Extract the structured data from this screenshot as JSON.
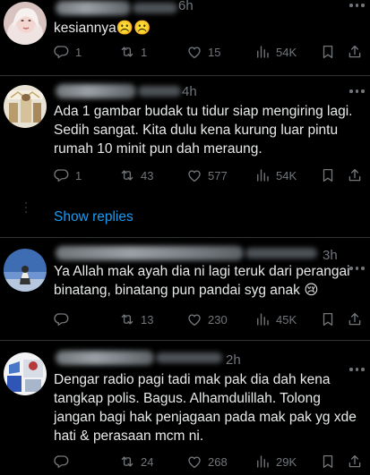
{
  "tweets": [
    {
      "time": "6h",
      "text": "kesiannya☹️☹️",
      "replies": "1",
      "retweets": "1",
      "likes": "15",
      "views": "54K"
    },
    {
      "time": "4h",
      "text": "Ada 1 gambar budak tu tidur siap mengiring lagi. Sedih sangat. Kita dulu kena kurung luar pintu rumah 10 minit pun dah meraung.",
      "replies": "1",
      "retweets": "43",
      "likes": "577",
      "views": "54K"
    },
    {
      "time": "3h",
      "text": "Ya Allah mak ayah dia ni lagi teruk dari perangai binatang, binatang pun pandai syg anak 😢",
      "replies": "",
      "retweets": "13",
      "likes": "230",
      "views": "45K"
    },
    {
      "time": "2h",
      "text": "Dengar radio pagi tadi mak pak dia dah kena tangkap polis. Bagus. Alhamdulillah. Tolong jangan bagi hak penjagaan pada mak pak yg xde hati & perasaan mcm ni.",
      "replies": "",
      "retweets": "24",
      "likes": "268",
      "views": "29K"
    }
  ],
  "show_replies_label": "Show replies",
  "colors": {
    "background": "#000000",
    "text": "#e7e9ea",
    "muted": "#71767b",
    "link": "#1d9bf0",
    "divider": "#2f3336"
  },
  "icons": [
    "reply-icon",
    "retweet-icon",
    "like-icon",
    "views-icon",
    "bookmark-icon",
    "share-icon",
    "more-icon"
  ]
}
